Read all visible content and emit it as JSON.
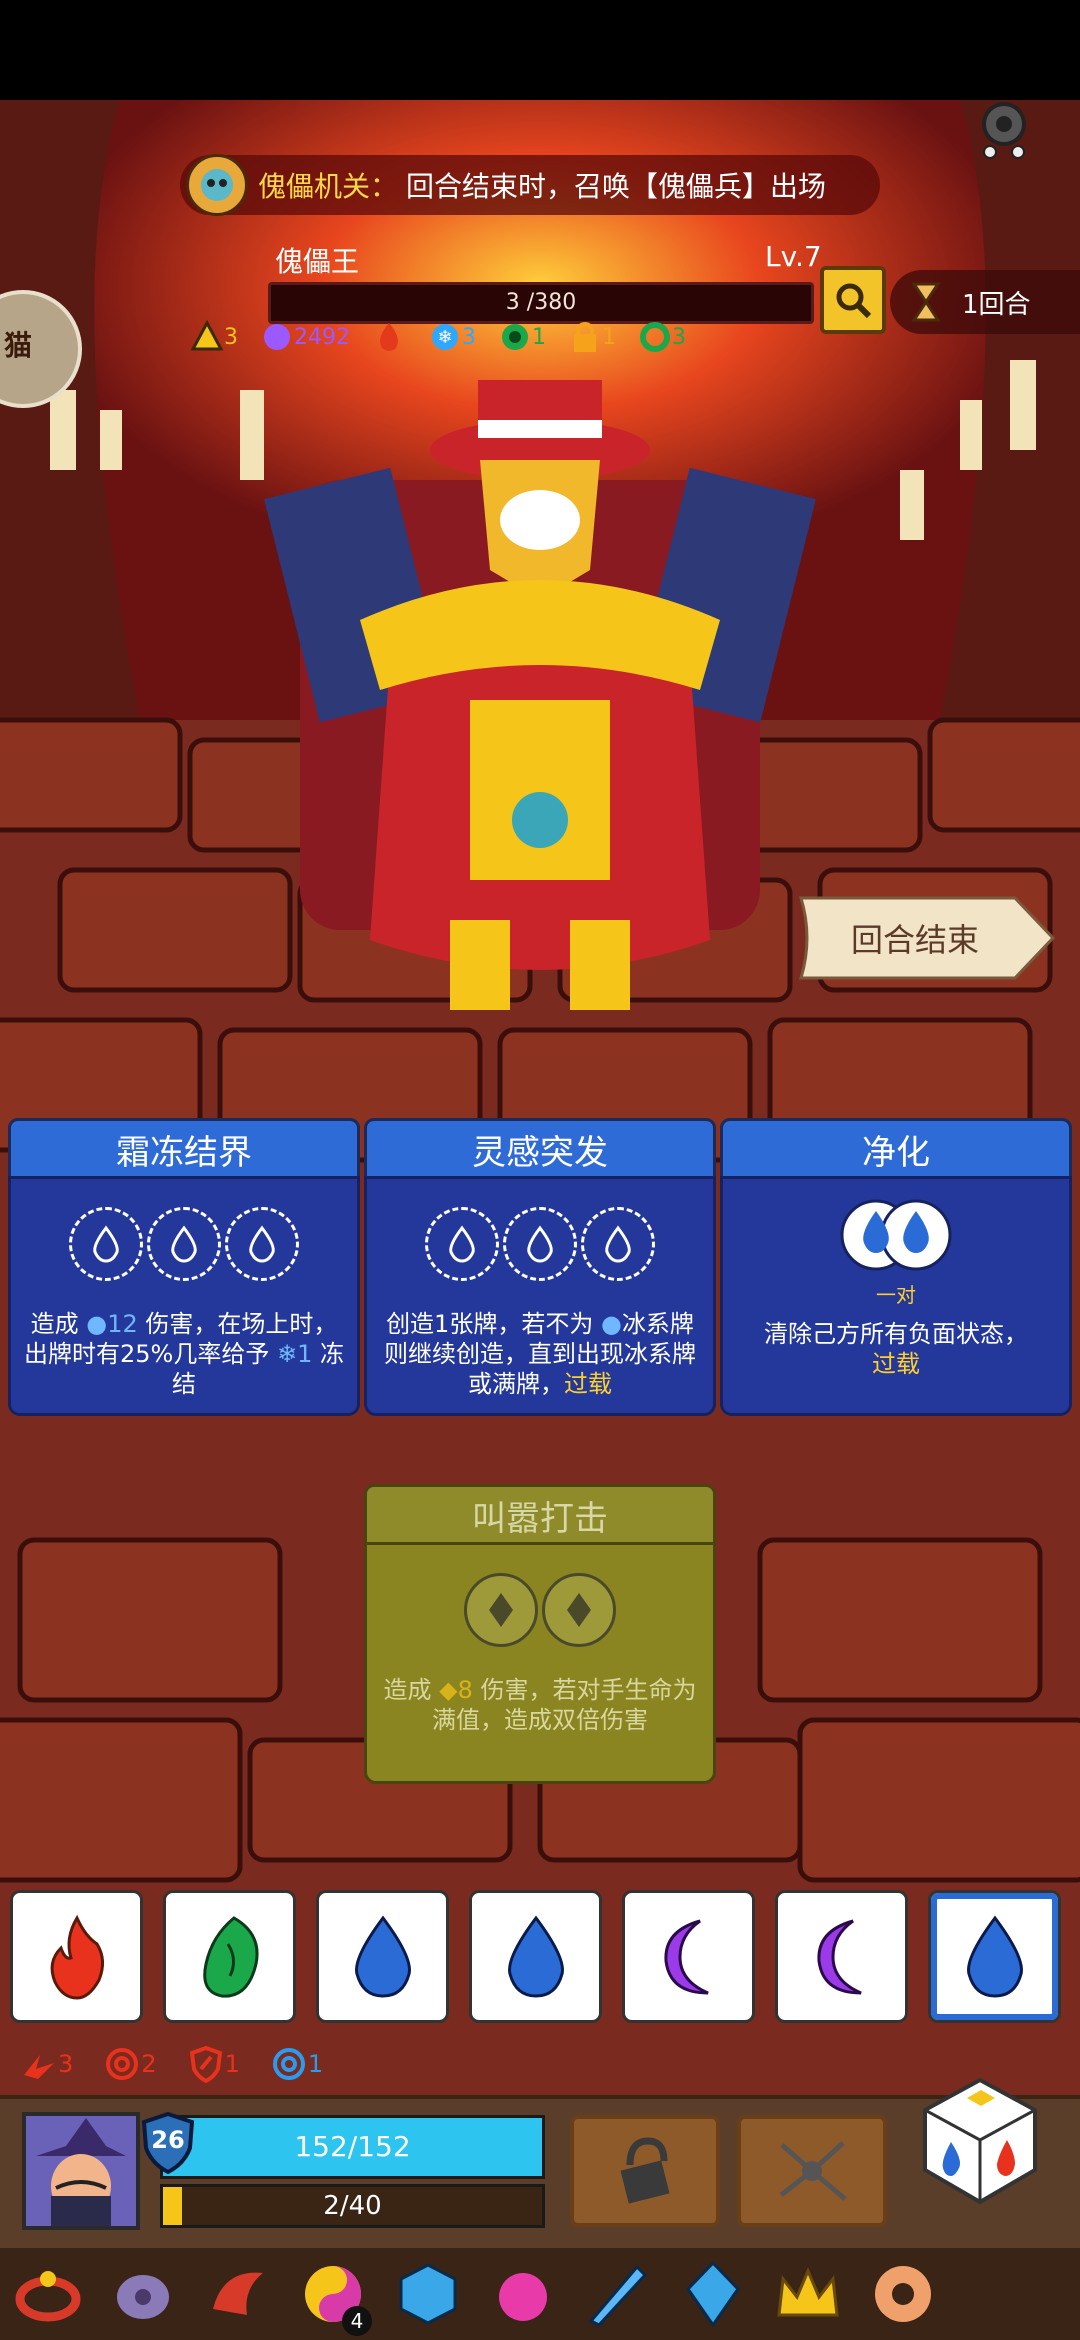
{
  "banner": {
    "title": "傀儡机关：",
    "text": "回合结束时，召唤【傀儡兵】出场"
  },
  "boss": {
    "name": "傀儡王",
    "level": "Lv.7",
    "hp_text": "3 /380",
    "buffs": [
      {
        "icon": "triangle-icon",
        "value": "3",
        "color": "#f5c51a"
      },
      {
        "icon": "purple-flower-icon",
        "value": "2492",
        "color": "#9b59ff"
      },
      {
        "icon": "fire-icon",
        "value": "",
        "color": "#e23a1a"
      },
      {
        "icon": "snowflake-icon",
        "value": "3",
        "color": "#2ea8ff"
      },
      {
        "icon": "green-swirl-icon",
        "value": "1",
        "color": "#1aa84a"
      },
      {
        "icon": "lock-icon",
        "value": "1",
        "color": "#f5a31a"
      },
      {
        "icon": "green-ring-icon",
        "value": "3",
        "color": "#1aa84a"
      }
    ]
  },
  "round": {
    "label": "1回合"
  },
  "side_cat": {
    "label": "猫"
  },
  "end_turn": {
    "label": "回合结束"
  },
  "cards": [
    {
      "title": "霜冻结界",
      "desc_a": "造成",
      "desc_dmg": "12",
      "desc_b": "伤害，在场上时，出牌时有25%几率给予",
      "desc_c": "1",
      "desc_d": "冻结"
    },
    {
      "title": "灵感突发",
      "desc_a": "创造1张牌，若不为",
      "desc_b": "冰系牌则继续创造，直到出现冰系牌或满牌，",
      "desc_hl": "过载"
    },
    {
      "title": "净化",
      "pair_label": "一对",
      "desc": "清除己方所有负面状态，",
      "desc_hl": "过载"
    },
    {
      "title": "叫嚣打击",
      "desc_a": "造成",
      "desc_dmg": "8",
      "desc_b": "伤害，若对手生命为满值，造成双倍伤害"
    }
  ],
  "dice": [
    {
      "face": "fire",
      "color": "#e8321e"
    },
    {
      "face": "leaf",
      "color": "#1aa84a"
    },
    {
      "face": "water",
      "color": "#2a6bd6"
    },
    {
      "face": "water",
      "color": "#2a6bd6"
    },
    {
      "face": "moon",
      "color": "#9b3ae8"
    },
    {
      "face": "moon",
      "color": "#9b3ae8"
    },
    {
      "face": "water",
      "color": "#2a6bd6",
      "selected": true
    }
  ],
  "player_status": [
    {
      "icon": "fire-claw-icon",
      "value": "3",
      "color": "#e8321e"
    },
    {
      "icon": "spiral-icon",
      "value": "2",
      "color": "#e8321e"
    },
    {
      "icon": "shield-break-icon",
      "value": "1",
      "color": "#e8321e"
    },
    {
      "icon": "blue-spiral-icon",
      "value": "1",
      "color": "#2a9cf0"
    }
  ],
  "player": {
    "level": "26",
    "hp_text": "152/152",
    "xp_text": "2/40",
    "xp_fraction": 0.05
  },
  "relics": [
    {
      "icon": "ring-relic-icon"
    },
    {
      "icon": "stone-relic-icon"
    },
    {
      "icon": "red-horn-relic-icon"
    },
    {
      "icon": "yin-yang-relic-icon",
      "badge": "4"
    },
    {
      "icon": "blue-die-relic-icon"
    },
    {
      "icon": "pink-flame-relic-icon"
    },
    {
      "icon": "blue-sword-relic-icon"
    },
    {
      "icon": "ice-crystal-relic-icon"
    },
    {
      "icon": "gold-crown-relic-icon"
    },
    {
      "icon": "donut-relic-icon"
    }
  ]
}
